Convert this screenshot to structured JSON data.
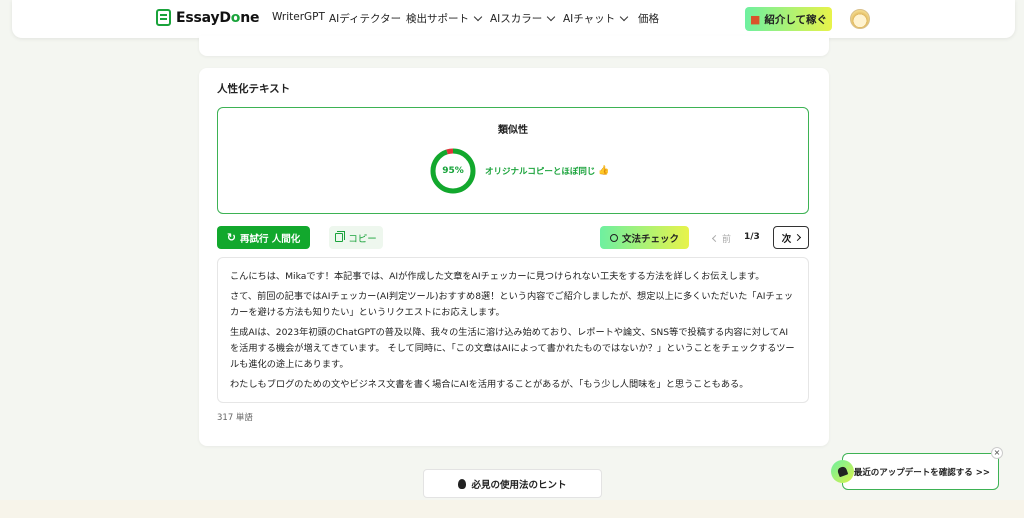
{
  "nav": {
    "logo_prefix": "EssayD",
    "logo_o": "o",
    "logo_suffix": "ne",
    "items": [
      {
        "label": "WriterGPT"
      },
      {
        "label": "AIディテクター"
      },
      {
        "label": "検出サポート"
      },
      {
        "label": "AIスカラー"
      },
      {
        "label": "AIチャット"
      },
      {
        "label": "価格"
      }
    ],
    "refer_label": "紹介して稼ぐ",
    "refer_icon": "gift-icon"
  },
  "card": {
    "title": "人性化テキスト",
    "similarity": {
      "title": "類似性",
      "percent": 95,
      "percent_label": "95%",
      "label": "オリジナルコピーとほぼ同じ",
      "ring_color": "#12a82d",
      "alert_color": "#e0343a"
    },
    "buttons": {
      "regen": "再試行 人間化",
      "copy": "コピー",
      "grammar": "文法チェック",
      "prev": "前",
      "page": "1/3",
      "next": "次"
    },
    "paragraphs": [
      "こんにちは、Mikaです！本記事では、AIが作成した文章をAIチェッカーに見つけられない工夫をする方法を詳しくお伝えします。",
      "さて、前回の記事ではAIチェッカー(AI判定ツール)おすすめ8選！という内容でご紹介しましたが、想定以上に多くいただいた「AIチェッカーを避ける方法も知りたい」というリクエストにお応えします。",
      "生成AIは、2023年初頭のChatGPTの普及以降、我々の生活に溶け込み始めており、レポートや論文、SNS等で投稿する内容に対してAIを活用する機会が増えてきています。 そして同時に、「この文章はAIによって書かれたものではないか？」ということをチェックするツールも進化の途上にあります。",
      "わたしもブログのための文やビジネス文書を書く場合にAIを活用することがあるが、「もう少し人間味を」と思うこともある。"
    ],
    "word_count": "317 単語"
  },
  "hint": {
    "label": "必見の使用法のヒント"
  },
  "update": {
    "label": "最近のアップデートを確認する >>",
    "close": "×"
  }
}
